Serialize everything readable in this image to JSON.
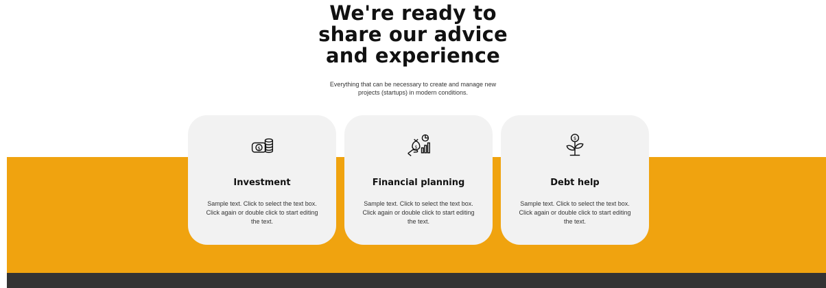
{
  "section": {
    "heading_lines": [
      "We're ready to",
      "share our advice",
      "and experience"
    ],
    "subtitle_lines": [
      "Everything that can be necessary to create and manage new",
      "projects (startups) in modern conditions."
    ]
  },
  "cards": [
    {
      "icon": "coins-icon",
      "title": "Investment",
      "text_lines": [
        "Sample text. Click to select the text box.",
        "Click again or double click to start editing",
        "the text."
      ]
    },
    {
      "icon": "financial-planning-icon",
      "title": "Financial planning",
      "text_lines": [
        "Sample text. Click to select the text box.",
        "Click again or double click to start editing",
        "the text."
      ]
    },
    {
      "icon": "money-plant-icon",
      "title": "Debt help",
      "text_lines": [
        "Sample text. Click to select the text box.",
        "Click again or double click to start editing",
        "the text."
      ]
    }
  ],
  "colors": {
    "accent": "#f0a30f",
    "footer": "#333333",
    "card_background": "#f2f2f2"
  }
}
